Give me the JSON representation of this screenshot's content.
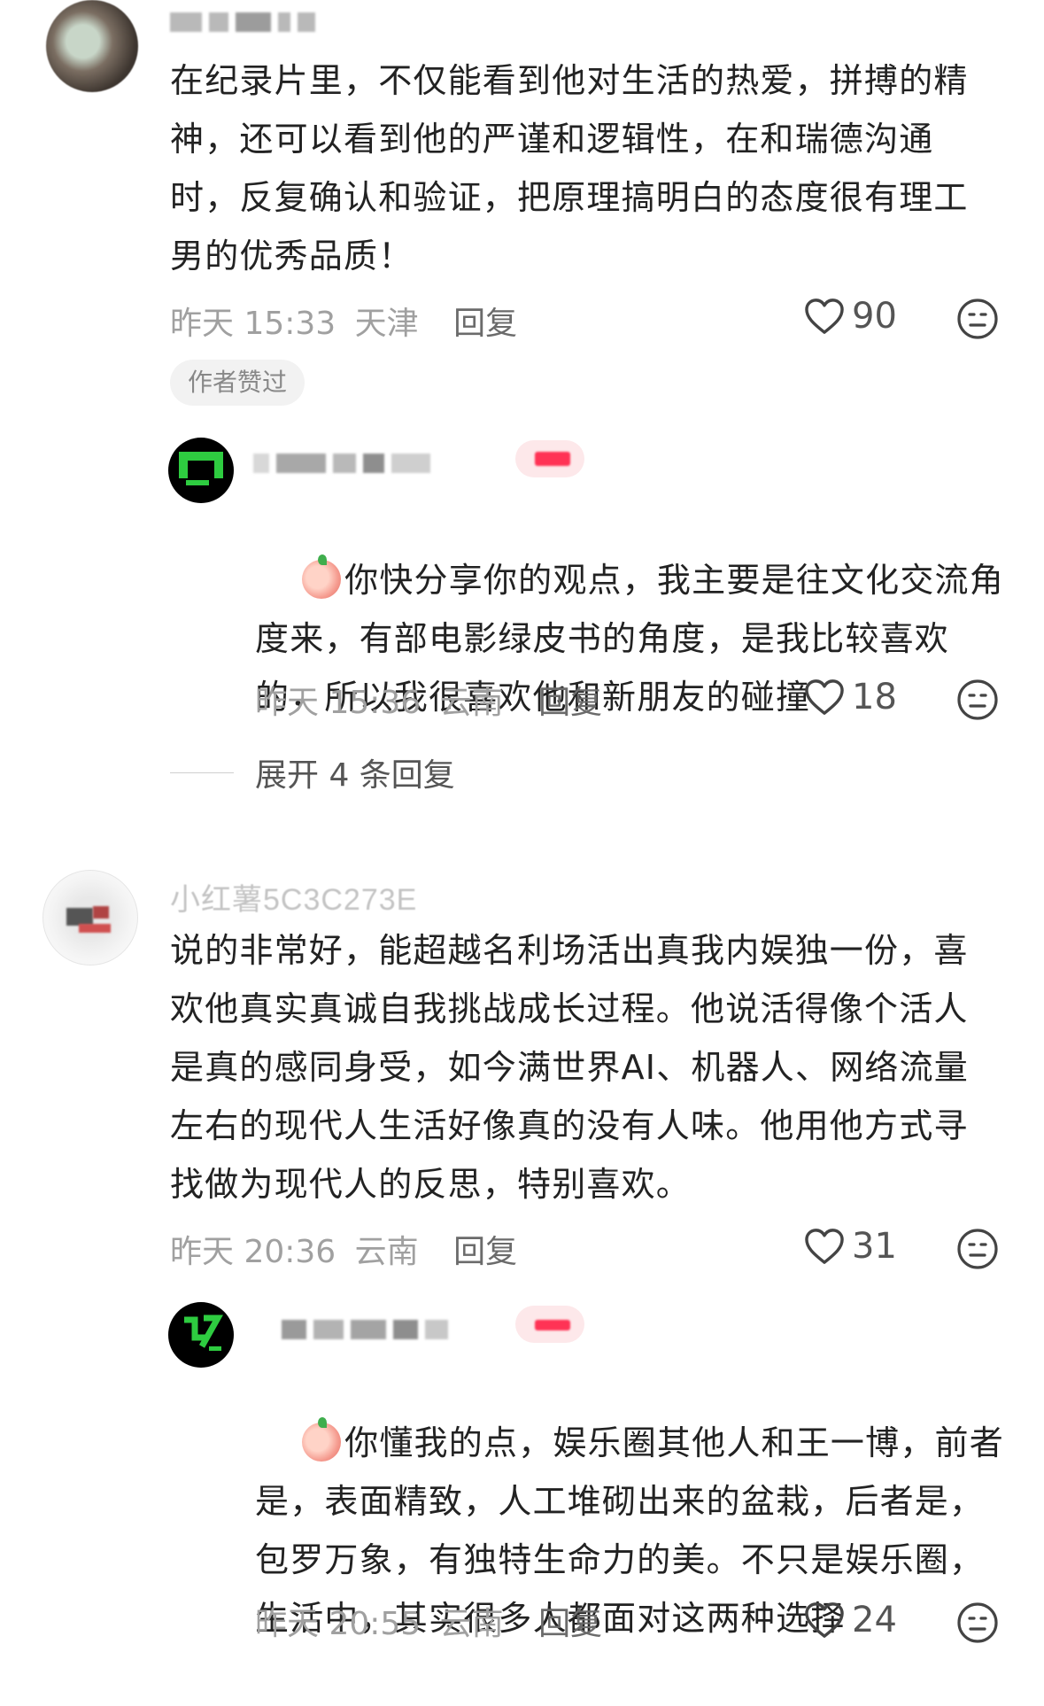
{
  "comments": [
    {
      "nickname": "",
      "text": "在纪录片里，不仅能看到他对生活的热爱，拼搏的精神，还可以看到他的严谨和逻辑性，在和瑞德沟通时，反复确认和验证，把原理搞明白的态度很有理工男的优秀品质！",
      "time": "昨天 15:33",
      "location": "天津",
      "reply_label": "回复",
      "likes": "90",
      "badge": "作者赞过",
      "author_reply": {
        "text": "你快分享你的观点，我主要是往文化交流角度来，有部电影绿皮书的角度，是我比较喜欢的，所以我很喜欢他和新朋友的碰撞",
        "time": "昨天 15:36",
        "location": "云南",
        "reply_label": "回复",
        "likes": "18"
      },
      "expand_label": "展开 4 条回复"
    },
    {
      "nickname": "小红薯5C3C273E",
      "text": "说的非常好，能超越名利场活出真我内娱独一份，喜欢他真实真诚自我挑战成长过程。他说活得像个活人是真的感同身受，如今满世界AI、机器人、网络流量左右的现代人生活好像真的没有人味。他用他方式寻找做为现代人的反思，特别喜欢。",
      "time": "昨天 20:36",
      "location": "云南",
      "reply_label": "回复",
      "likes": "31",
      "author_reply": {
        "text": "你懂我的点，娱乐圈其他人和王一博，前者是，表面精致，人工堆砌出来的盆栽，后者是，包罗万象，有独特生命力的美。不只是娱乐圈，生活中，其实很多人都面对这两种选择",
        "time": "昨天 20:55",
        "location": "云南",
        "reply_label": "回复",
        "likes": "24"
      }
    }
  ],
  "icons": {
    "like": "heart-outline-icon",
    "more": "neutral-face-icon",
    "emoji": "peach-emoji-icon"
  },
  "colors": {
    "author_tag": "#ff3355",
    "meta": "#a0a0a0",
    "text": "#222222"
  }
}
